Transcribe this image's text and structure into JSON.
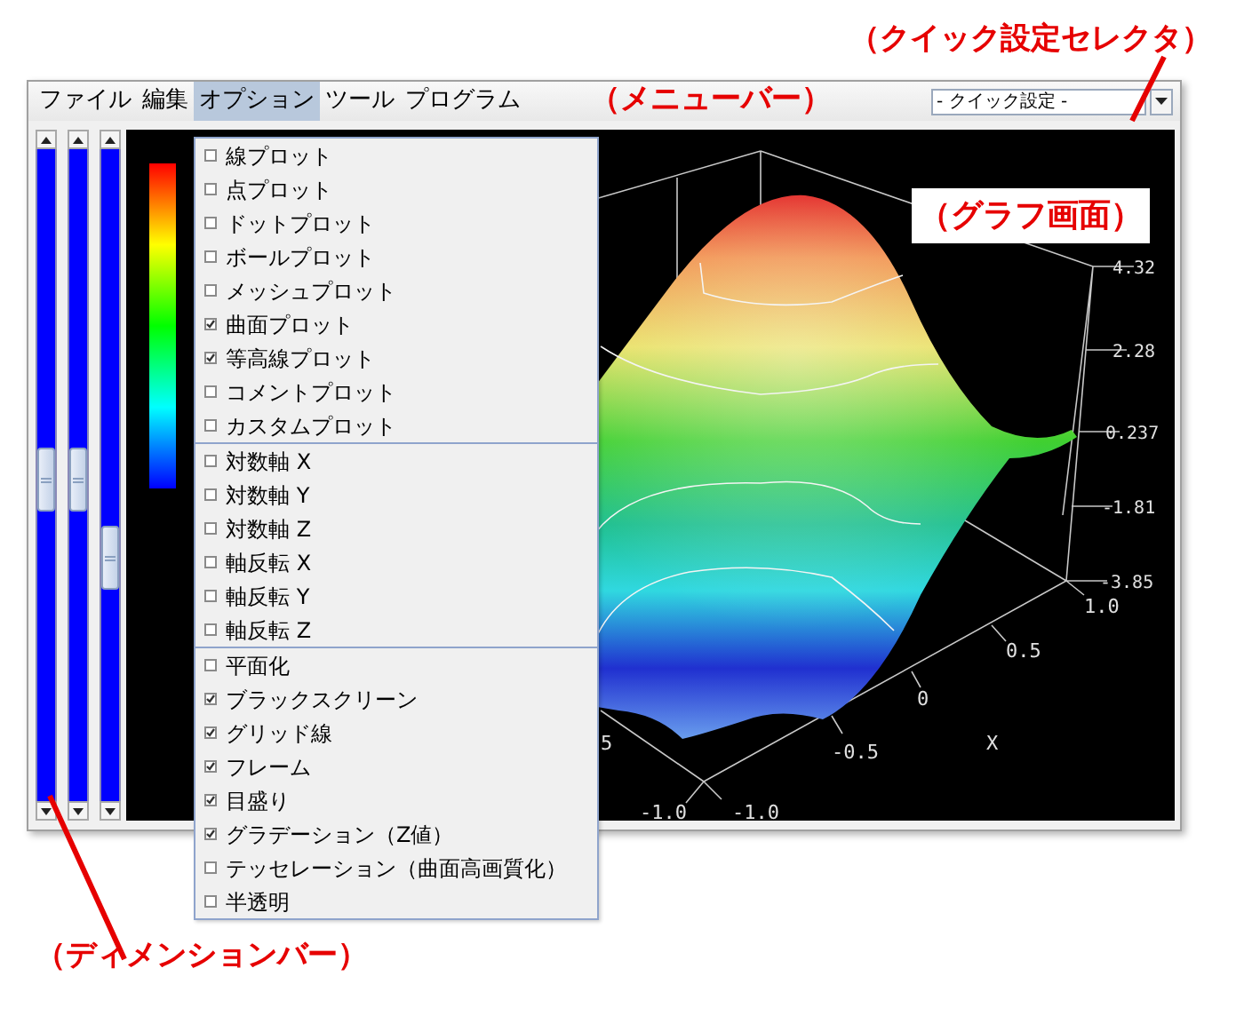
{
  "callouts": {
    "quick_settings": "（クイック設定セレクタ）",
    "menu_bar": "（メニューバー）",
    "graph": "（グラフ画面）",
    "dimension_bar": "（ディメンションバー）"
  },
  "menu_bar": {
    "items": [
      {
        "label": "ファイル",
        "selected": false
      },
      {
        "label": "編集",
        "selected": false
      },
      {
        "label": "オプション",
        "selected": true
      },
      {
        "label": "ツール",
        "selected": false
      },
      {
        "label": "プログラム",
        "selected": false
      }
    ]
  },
  "quick_settings": {
    "value": "- クイック設定 -"
  },
  "options_menu": {
    "groups": [
      [
        {
          "label": "線プロット",
          "checked": false
        },
        {
          "label": "点プロット",
          "checked": false
        },
        {
          "label": "ドットプロット",
          "checked": false
        },
        {
          "label": "ボールプロット",
          "checked": false
        },
        {
          "label": "メッシュプロット",
          "checked": false
        },
        {
          "label": "曲面プロット",
          "checked": true
        },
        {
          "label": "等高線プロット",
          "checked": true
        },
        {
          "label": "コメントプロット",
          "checked": false
        },
        {
          "label": "カスタムプロット",
          "checked": false
        }
      ],
      [
        {
          "label": "対数軸 X",
          "checked": false
        },
        {
          "label": "対数軸 Y",
          "checked": false
        },
        {
          "label": "対数軸 Z",
          "checked": false
        },
        {
          "label": "軸反転 X",
          "checked": false
        },
        {
          "label": "軸反転 Y",
          "checked": false
        },
        {
          "label": "軸反転 Z",
          "checked": false
        }
      ],
      [
        {
          "label": "平面化",
          "checked": false
        },
        {
          "label": "ブラックスクリーン",
          "checked": true
        },
        {
          "label": "グリッド線",
          "checked": true
        },
        {
          "label": "フレーム",
          "checked": true
        },
        {
          "label": "目盛り",
          "checked": true
        },
        {
          "label": "グラデーション（Z値）",
          "checked": true
        },
        {
          "label": "テッセレーション（曲面高画質化）",
          "checked": false
        },
        {
          "label": "半透明",
          "checked": false
        }
      ]
    ]
  },
  "graph": {
    "z_ticks": [
      "4.32",
      "2.28",
      "0.237",
      "-1.81",
      "-3.85"
    ],
    "x_ticks": [
      "1.0",
      "0.5",
      "0",
      "-0.5",
      "-1.0"
    ],
    "x_label": "X",
    "y_ticks": [
      "5",
      "-1.0"
    ]
  }
}
